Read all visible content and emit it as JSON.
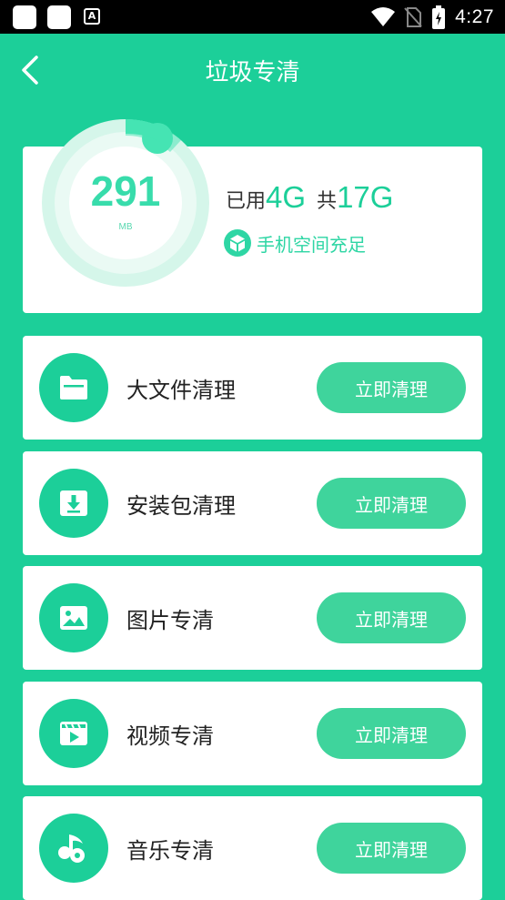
{
  "status_bar": {
    "time": "4:27"
  },
  "header": {
    "title": "垃圾专清"
  },
  "storage": {
    "junk_value": "291",
    "junk_unit": "MB",
    "used_label": "已用",
    "used_value": "4G",
    "total_label": "共",
    "total_value": "17G",
    "status_text": "手机空间充足"
  },
  "items": [
    {
      "label": "大文件清理",
      "button": "立即清理",
      "icon": "folder-icon"
    },
    {
      "label": "安装包清理",
      "button": "立即清理",
      "icon": "download-icon"
    },
    {
      "label": "图片专清",
      "button": "立即清理",
      "icon": "image-icon"
    },
    {
      "label": "视频专清",
      "button": "立即清理",
      "icon": "video-icon"
    },
    {
      "label": "音乐专清",
      "button": "立即清理",
      "icon": "music-icon"
    }
  ],
  "colors": {
    "accent": "#1ccf99",
    "button": "#3fd49c",
    "ring": "#38dcab"
  }
}
